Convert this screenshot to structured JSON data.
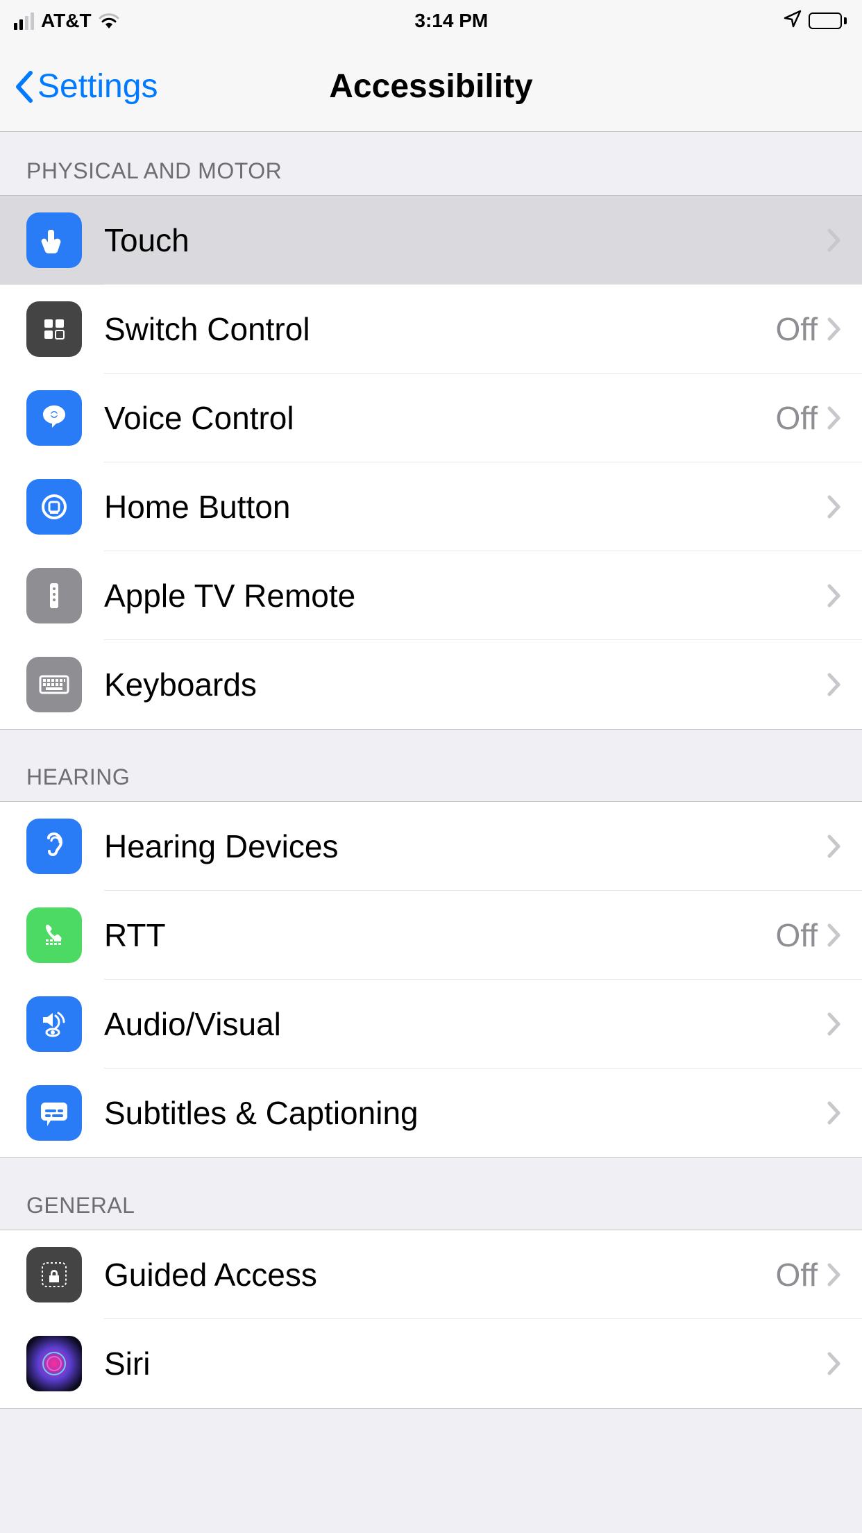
{
  "status": {
    "carrier": "AT&T",
    "time": "3:14 PM"
  },
  "nav": {
    "back": "Settings",
    "title": "Accessibility"
  },
  "sections": [
    {
      "header": "PHYSICAL AND MOTOR",
      "items": [
        {
          "label": "Touch",
          "value": "",
          "icon": "touch",
          "selected": true
        },
        {
          "label": "Switch Control",
          "value": "Off",
          "icon": "switch-control"
        },
        {
          "label": "Voice Control",
          "value": "Off",
          "icon": "voice-control"
        },
        {
          "label": "Home Button",
          "value": "",
          "icon": "home-button"
        },
        {
          "label": "Apple TV Remote",
          "value": "",
          "icon": "apple-tv-remote"
        },
        {
          "label": "Keyboards",
          "value": "",
          "icon": "keyboards"
        }
      ]
    },
    {
      "header": "HEARING",
      "items": [
        {
          "label": "Hearing Devices",
          "value": "",
          "icon": "hearing-devices"
        },
        {
          "label": "RTT",
          "value": "Off",
          "icon": "rtt"
        },
        {
          "label": "Audio/Visual",
          "value": "",
          "icon": "audio-visual"
        },
        {
          "label": "Subtitles & Captioning",
          "value": "",
          "icon": "subtitles"
        }
      ]
    },
    {
      "header": "GENERAL",
      "items": [
        {
          "label": "Guided Access",
          "value": "Off",
          "icon": "guided-access"
        },
        {
          "label": "Siri",
          "value": "",
          "icon": "siri"
        }
      ]
    }
  ]
}
